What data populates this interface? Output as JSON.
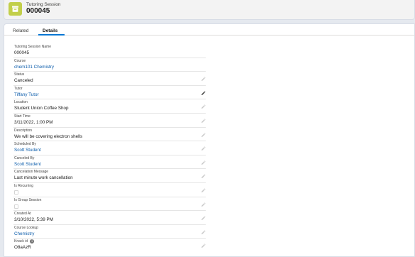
{
  "header": {
    "object_type": "Tutoring Session",
    "record_name": "000045",
    "icon": "tutoring-session-object-icon"
  },
  "tabs": [
    {
      "label": "Related",
      "active": false
    },
    {
      "label": "Details",
      "active": true
    }
  ],
  "fields": [
    {
      "name": "tutoring-session-name",
      "label": "Tutoring Session Name",
      "value": "000045",
      "link": false,
      "editable": false,
      "type": "text"
    },
    {
      "name": "course",
      "label": "Course",
      "value": "chem101 Chemistry",
      "link": true,
      "editable": false,
      "type": "text"
    },
    {
      "name": "status",
      "label": "Status",
      "value": "Canceled",
      "link": false,
      "editable": true,
      "type": "text"
    },
    {
      "name": "tutor",
      "label": "Tutor",
      "value": "Tiffany Tutor",
      "link": true,
      "editable": true,
      "type": "text"
    },
    {
      "name": "location",
      "label": "Location",
      "value": "Student Union Coffee Shop",
      "link": false,
      "editable": true,
      "type": "text"
    },
    {
      "name": "start-time",
      "label": "Start Time",
      "value": "3/11/2022, 1:00 PM",
      "link": false,
      "editable": true,
      "type": "text"
    },
    {
      "name": "description",
      "label": "Description",
      "value": "We will be covering electron shells",
      "link": false,
      "editable": true,
      "type": "text"
    },
    {
      "name": "scheduled-by",
      "label": "Scheduled By",
      "value": "Scott Student",
      "link": true,
      "editable": true,
      "type": "text"
    },
    {
      "name": "canceled-by",
      "label": "Canceled By",
      "value": "Scott Student",
      "link": true,
      "editable": true,
      "type": "text"
    },
    {
      "name": "cancelation-message",
      "label": "Cancelation Message",
      "value": "Last minute work cancellation",
      "link": false,
      "editable": true,
      "type": "text"
    },
    {
      "name": "is-recurring",
      "label": "Is Recurring",
      "value": "",
      "link": false,
      "editable": true,
      "type": "checkbox"
    },
    {
      "name": "is-group-session",
      "label": "Is Group Session",
      "value": "",
      "link": false,
      "editable": true,
      "type": "checkbox"
    },
    {
      "name": "created-at",
      "label": "Created At",
      "value": "3/10/2022, 5:39 PM",
      "link": false,
      "editable": true,
      "type": "text"
    },
    {
      "name": "course-lookup",
      "label": "Course Lookup",
      "value": "Chemistry",
      "link": true,
      "editable": true,
      "type": "text"
    },
    {
      "name": "knack-id",
      "label": "Knack id",
      "value": "O8aAzR",
      "link": false,
      "editable": true,
      "type": "text",
      "info": true
    }
  ],
  "colors": {
    "icon_bg": "#c2cf4a",
    "link": "#0b5cab",
    "tab_active": "#0176d3"
  }
}
